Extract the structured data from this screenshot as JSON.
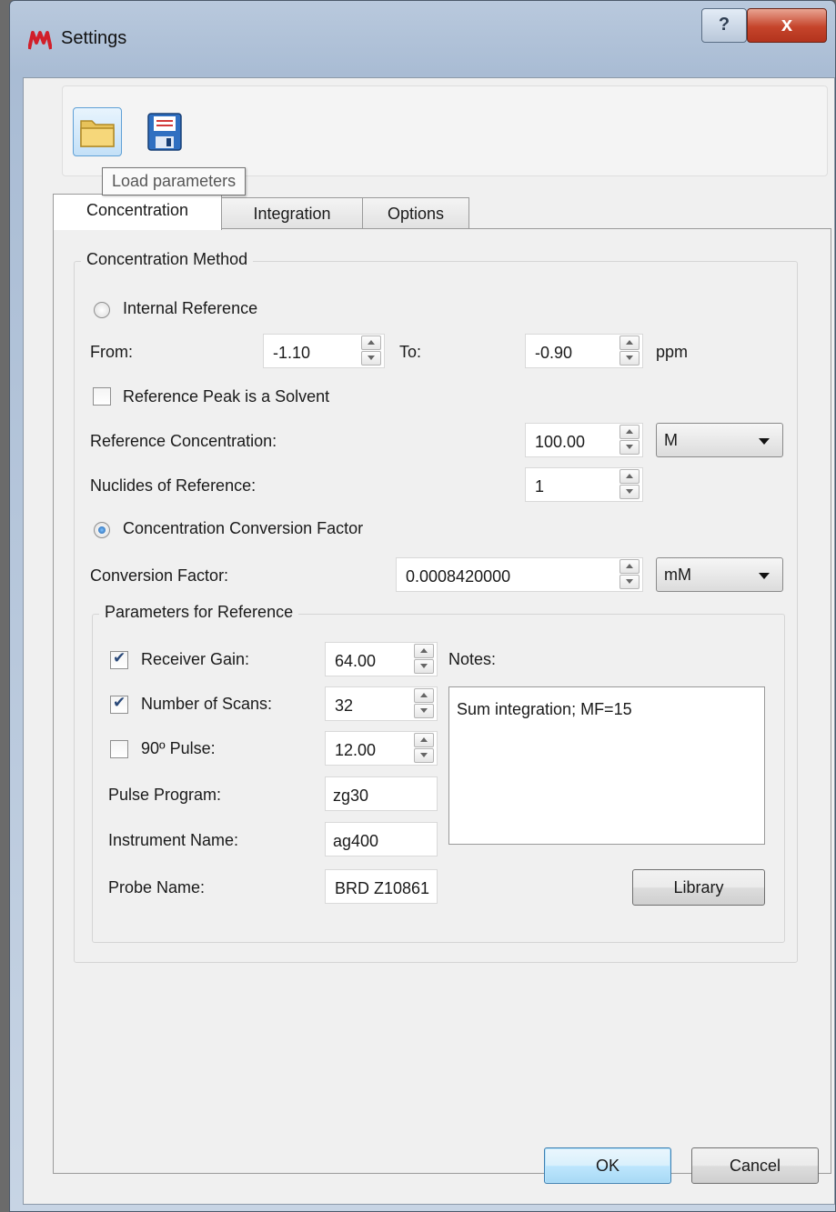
{
  "window": {
    "title": "Settings",
    "help_label": "?",
    "close_label": "x"
  },
  "toolbar": {
    "load_icon": "folder-open-icon",
    "save_icon": "floppy-disk-icon",
    "tooltip": "Load parameters"
  },
  "tabs": [
    {
      "label": "Concentration",
      "active": true
    },
    {
      "label": "Integration",
      "active": false
    },
    {
      "label": "Options",
      "active": false
    }
  ],
  "concentration_method": {
    "title": "Concentration Method",
    "internal_reference": {
      "label": "Internal Reference",
      "selected": false
    },
    "from_label": "From:",
    "from_value": "-1.10",
    "to_label": "To:",
    "to_value": "-0.90",
    "ppm_label": "ppm",
    "solvent_label": "Reference Peak is a Solvent",
    "solvent_checked": false,
    "ref_conc_label": "Reference Concentration:",
    "ref_conc_value": "100.00",
    "ref_conc_unit": "M",
    "nuclides_label": "Nuclides of Reference:",
    "nuclides_value": "1",
    "conversion_factor_option": {
      "label": "Concentration Conversion Factor",
      "selected": true
    },
    "conv_factor_label": "Conversion Factor:",
    "conv_factor_value": "0.0008420000",
    "conv_factor_unit": "mM"
  },
  "parameters": {
    "title": "Parameters for Reference",
    "receiver_gain": {
      "label": "Receiver Gain:",
      "checked": true,
      "value": "64.00"
    },
    "number_of_scans": {
      "label": "Number of Scans:",
      "checked": true,
      "value": "32"
    },
    "pulse_90": {
      "label": "90º Pulse:",
      "checked": false,
      "value": "12.00"
    },
    "pulse_program": {
      "label": "Pulse Program:",
      "value": "zg30"
    },
    "instrument_name": {
      "label": "Instrument Name:",
      "value": "ag400"
    },
    "probe_name": {
      "label": "Probe Name:",
      "value": "BRD Z10861"
    },
    "notes_label": "Notes:",
    "notes_value": "Sum integration; MF=15",
    "library_label": "Library"
  },
  "buttons": {
    "ok": "OK",
    "cancel": "Cancel"
  },
  "colors": {
    "accent": "#3c7fb1",
    "close": "#c5442b",
    "frame": "#b9c9dd"
  }
}
